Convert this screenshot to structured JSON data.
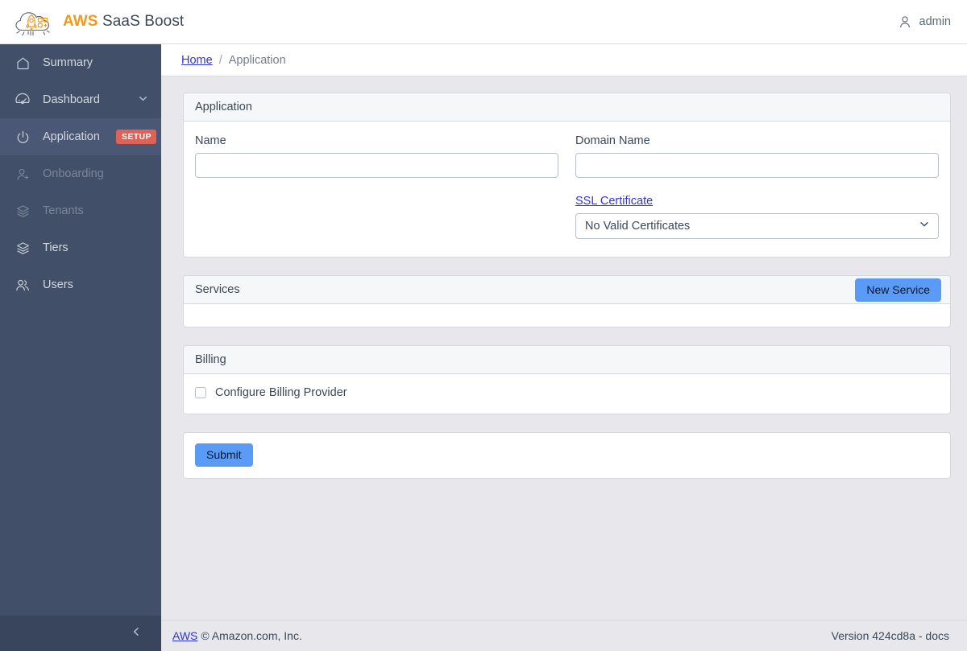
{
  "brand": {
    "logo_icon": "cloud-rocket-logo",
    "name_accent": "AWS",
    "name_rest": " SaaS Boost"
  },
  "header": {
    "user_icon": "user-icon",
    "username": "admin"
  },
  "sidebar": {
    "items": [
      {
        "label": "Summary",
        "icon": "home-icon",
        "state": "normal",
        "badge": null,
        "chevron": false
      },
      {
        "label": "Dashboard",
        "icon": "speedometer-icon",
        "state": "normal",
        "badge": null,
        "chevron": true
      },
      {
        "label": "Application",
        "icon": "power-icon",
        "state": "active",
        "badge": "SETUP",
        "chevron": false
      },
      {
        "label": "Onboarding",
        "icon": "user-plus-icon",
        "state": "disabled",
        "badge": null,
        "chevron": false
      },
      {
        "label": "Tenants",
        "icon": "layers-icon",
        "state": "disabled",
        "badge": null,
        "chevron": false
      },
      {
        "label": "Tiers",
        "icon": "layers-icon",
        "state": "normal",
        "badge": null,
        "chevron": false
      },
      {
        "label": "Users",
        "icon": "users-icon",
        "state": "normal",
        "badge": null,
        "chevron": false
      }
    ],
    "minimizer_icon": "chevron-left-icon"
  },
  "breadcrumb": {
    "home_label": "Home",
    "separator": "/",
    "current_label": "Application"
  },
  "application_card": {
    "title": "Application",
    "name_label": "Name",
    "name_value": "",
    "name_placeholder": "",
    "domain_label": "Domain Name",
    "domain_value": "",
    "domain_placeholder": "",
    "ssl_label": "SSL Certificate",
    "ssl_selected": "No Valid Certificates",
    "ssl_chevron_icon": "chevron-down-icon"
  },
  "services_card": {
    "title": "Services",
    "new_service_label": "New Service"
  },
  "billing_card": {
    "title": "Billing",
    "checkbox_label": "Configure Billing Provider",
    "checkbox_checked": false
  },
  "submit_card": {
    "submit_label": "Submit"
  },
  "footer": {
    "aws_link": "AWS",
    "copyright": "© Amazon.com, Inc.",
    "version": "Version 424cd8a - docs"
  },
  "colors": {
    "sidebar_bg": "#414f68",
    "sidebar_active_bg": "#4a5875",
    "accent_blue": "#5b9bf8",
    "link_blue": "#2f36d8",
    "badge_red": "#e06257",
    "brand_orange": "#f2991c",
    "page_bg": "#e8e8ec"
  }
}
